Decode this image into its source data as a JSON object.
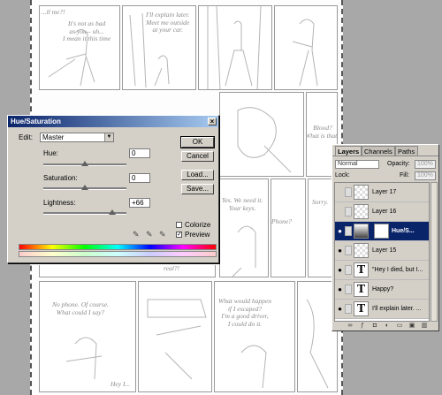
{
  "comic": {
    "panel_texts": [
      "...ll me?!",
      "It's not as bad\nas you-- uh...\nI mean it this time",
      "I'll explain later.\nMeet me outside\nat your car.",
      "Blood?\nWhat is that?",
      "Yes. We need it.\nYour keys.",
      "Phone?",
      "Sorry.",
      "real?!",
      "No phone. Of course.\nWhat could I say?",
      "What would happen\nif I escaped?\nI'm a good driver,\nI could do it.",
      "Hey I..."
    ]
  },
  "hue_saturation": {
    "title": "Hue/Saturation",
    "close_glyph": "×",
    "edit_label": "Edit:",
    "edit_value": "Master",
    "hue_label": "Hue:",
    "hue_value": "0",
    "saturation_label": "Saturation:",
    "saturation_value": "0",
    "lightness_label": "Lightness:",
    "lightness_value": "+66",
    "lightness_level_percent": 83,
    "buttons": {
      "ok": "OK",
      "cancel": "Cancel",
      "load": "Load...",
      "save": "Save..."
    },
    "colorize_label": "Colorize",
    "colorize_checked": false,
    "preview_label": "Preview",
    "preview_checked": true,
    "check_glyph": "✓"
  },
  "layers_panel": {
    "tabs": [
      "Layers",
      "Channels",
      "Paths"
    ],
    "active_tab": "Layers",
    "blend_mode": "Normal",
    "opacity_label": "Opacity:",
    "opacity_value": "100%",
    "lock_label": "Lock:",
    "fill_label": "Fill:",
    "fill_value": "100%",
    "layers": [
      {
        "name": "Layer 17",
        "kind": "raster",
        "visible": false,
        "selected": false
      },
      {
        "name": "Layer 16",
        "kind": "raster",
        "visible": false,
        "selected": false
      },
      {
        "name": "Hue/S...",
        "kind": "adjustment",
        "visible": true,
        "selected": true
      },
      {
        "name": "Layer 15",
        "kind": "raster",
        "visible": true,
        "selected": false
      },
      {
        "name": "\"Hey I died, but I...",
        "kind": "text",
        "visible": true,
        "selected": false
      },
      {
        "name": "Happy?",
        "kind": "text",
        "visible": true,
        "selected": false
      },
      {
        "name": "I'll explain later. ...",
        "kind": "text",
        "visible": true,
        "selected": false
      }
    ],
    "text_thumb_glyph": "T",
    "eye_glyph": "●"
  }
}
